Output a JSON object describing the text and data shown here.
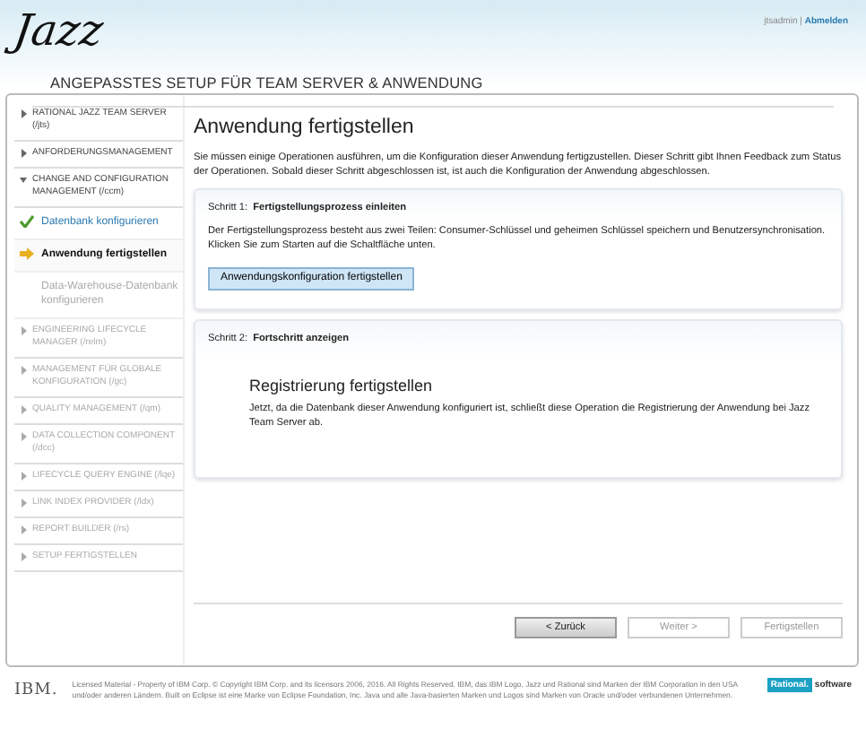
{
  "header": {
    "logo": "Jazz",
    "subtitle": "ANGEPASSTES SETUP FÜR TEAM SERVER & ANWENDUNG",
    "user": "jtsadmin",
    "separator": "|",
    "logout": "Abmelden"
  },
  "sidebar": {
    "items": [
      {
        "kind": "section",
        "label": "RATIONAL JAZZ TEAM SERVER (/jts)",
        "expanded": false,
        "disabled": false
      },
      {
        "kind": "section",
        "label": "ANFORDERUNGSMANAGEMENT",
        "expanded": false,
        "disabled": false
      },
      {
        "kind": "section",
        "label": "CHANGE AND CONFIGURATION MANAGEMENT (/ccm)",
        "expanded": true,
        "disabled": false,
        "children": [
          {
            "kind": "done",
            "label": "Datenbank konfigurieren",
            "selected": false
          },
          {
            "kind": "current",
            "label": "Anwendung fertigstellen",
            "selected": true
          },
          {
            "kind": "pending",
            "label": "Data-Warehouse-Datenbank konfigurieren",
            "selected": false
          }
        ]
      },
      {
        "kind": "section",
        "label": "ENGINEERING LIFECYCLE MANAGER (/relm)",
        "expanded": false,
        "disabled": true
      },
      {
        "kind": "section",
        "label": "MANAGEMENT FÜR GLOBALE KONFIGURATION (/gc)",
        "expanded": false,
        "disabled": true
      },
      {
        "kind": "section",
        "label": "QUALITY MANAGEMENT (/qm)",
        "expanded": false,
        "disabled": true
      },
      {
        "kind": "section",
        "label": "DATA COLLECTION COMPONENT (/dcc)",
        "expanded": false,
        "disabled": true
      },
      {
        "kind": "section",
        "label": "LIFECYCLE QUERY ENGINE (/lqe)",
        "expanded": false,
        "disabled": true
      },
      {
        "kind": "section",
        "label": "LINK INDEX PROVIDER (/ldx)",
        "expanded": false,
        "disabled": true
      },
      {
        "kind": "section",
        "label": "REPORT BUILDER (/rs)",
        "expanded": false,
        "disabled": true
      },
      {
        "kind": "section",
        "label": "SETUP FERTIGSTELLEN",
        "expanded": false,
        "disabled": true
      }
    ]
  },
  "content": {
    "title": "Anwendung fertigstellen",
    "intro": "Sie müssen einige Operationen ausführen, um die Konfiguration dieser Anwendung fertigzustellen. Dieser Schritt gibt Ihnen Feedback zum Status der Operationen. Sobald dieser Schritt abgeschlossen ist, ist auch die Konfiguration der Anwendung abgeschlossen.",
    "steps": [
      {
        "number": "Schritt 1:",
        "title": "Fertigstellungsprozess einleiten",
        "text": "Der Fertigstellungsprozess besteht aus zwei Teilen: Consumer-Schlüssel und geheimen Schlüssel speichern und Benutzersynchronisation. Klicken Sie zum Starten auf die Schaltfläche unten.",
        "button": "Anwendungskonfiguration fertigstellen"
      },
      {
        "number": "Schritt 2:",
        "title": "Fortschritt anzeigen",
        "heading": "Registrierung fertigstellen",
        "text": "Jetzt, da die Datenbank dieser Anwendung konfiguriert ist, schließt diese Operation die Registrierung der Anwendung bei Jazz Team Server ab."
      }
    ],
    "buttons": [
      {
        "label": "< Zurück",
        "disabled": false
      },
      {
        "label": "Weiter >",
        "disabled": true
      },
      {
        "label": "Fertigstellen",
        "disabled": true
      }
    ]
  },
  "footer": {
    "vendor": "IBM.",
    "legal": "Licensed Material - Property of IBM Corp. © Copyright IBM Corp. and its licensors 2006, 2016. All Rights Reserved. IBM, das IBM Logo, Jazz und Rational sind Marken der IBM Corporation in den USA und/oder anderen Ländern. Built on Eclipse ist eine Marke von Eclipse Foundation, Inc. Java und alle Java-basierten Marken und Logos sind Marken von Oracle und/oder verbundenen Unternehmen.",
    "brand": "Rational.",
    "brand_suffix": "software"
  }
}
